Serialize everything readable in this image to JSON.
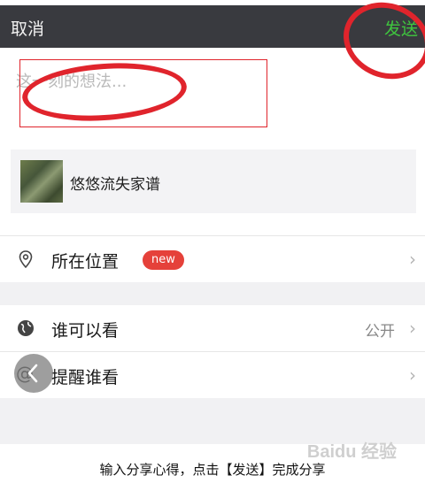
{
  "header": {
    "cancel_label": "取消",
    "send_label": "发送"
  },
  "compose": {
    "placeholder": "这一刻的想法..."
  },
  "share_card": {
    "title": "悠悠流失家谱"
  },
  "rows": {
    "location": {
      "label": "所在位置",
      "badge": "new"
    },
    "visibility": {
      "label": "谁可以看",
      "value": "公开"
    },
    "remind": {
      "label": "提醒谁看"
    }
  },
  "caption": "输入分享心得，点击【发送】完成分享",
  "watermark": "Baidu 经验",
  "colors": {
    "send": "#3fc53f",
    "annotation": "#e0242c",
    "header_bg": "#393a3f",
    "badge": "#e5413a"
  }
}
